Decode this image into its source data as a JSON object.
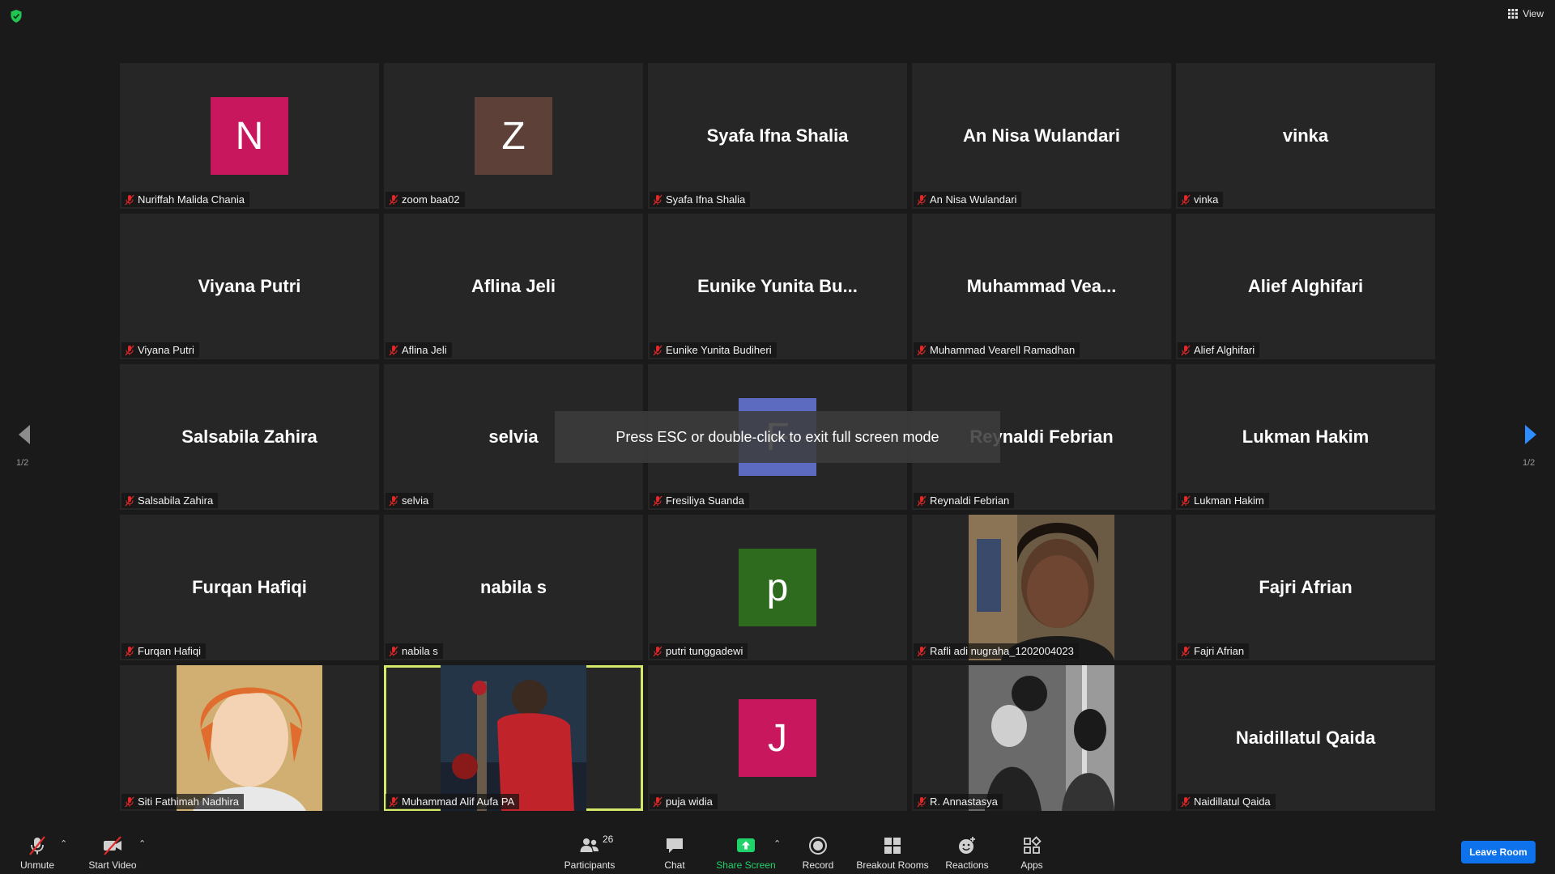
{
  "top_bar": {
    "view_label": "View",
    "security_icon": "shield-check-icon",
    "view_icon": "grid-icon"
  },
  "tiles": [
    {
      "display": "N",
      "avatar_color": "#c8175d",
      "name": "Nuriffah Malida Chania",
      "muted": true
    },
    {
      "display": "Z",
      "avatar_color": "#5d4037",
      "name": "zoom baa02",
      "muted": true
    },
    {
      "display": "Syafa Ifna Shalia",
      "name": "Syafa Ifna Shalia",
      "muted": true
    },
    {
      "display": "An Nisa Wulandari",
      "name": "An Nisa Wulandari",
      "muted": true
    },
    {
      "display": "vinka",
      "name": "vinka",
      "muted": true
    },
    {
      "display": "Viyana Putri",
      "name": "Viyana Putri",
      "muted": true
    },
    {
      "display": "Aflina Jeli",
      "name": "Aflina Jeli",
      "muted": true
    },
    {
      "display": "Eunike Yunita Bu...",
      "name": "Eunike Yunita Budiheri",
      "muted": true
    },
    {
      "display": "Muhammad Vea...",
      "name": "Muhammad Vearell Ramadhan",
      "muted": true
    },
    {
      "display": "Alief Alghifari",
      "name": "Alief Alghifari",
      "muted": true
    },
    {
      "display": "Salsabila Zahira",
      "name": "Salsabila Zahira",
      "muted": true
    },
    {
      "display": "selvia",
      "name": "selvia",
      "muted": true
    },
    {
      "display": "F",
      "avatar_color": "#5c6bc0",
      "name": "Fresiliya Suanda",
      "muted": true
    },
    {
      "display": "Reynaldi Febrian",
      "name": "Reynaldi Febrian",
      "muted": true
    },
    {
      "display": "Lukman Hakim",
      "name": "Lukman Hakim",
      "muted": true
    },
    {
      "display": "Furqan Hafiqi",
      "name": "Furqan Hafiqi",
      "muted": true
    },
    {
      "display": "nabila s",
      "name": "nabila s",
      "muted": true
    },
    {
      "display": "p",
      "avatar_color": "#2e6b1f",
      "name": "putri tunggadewi",
      "muted": true
    },
    {
      "display": "",
      "photo": "webcam-portrait",
      "name": "Rafli adi nugraha_1202004023",
      "muted": true
    },
    {
      "display": "Fajri Afrian",
      "name": "Fajri Afrian",
      "muted": true
    },
    {
      "display": "",
      "photo": "anime-portrait",
      "name": "Siti Fathimah Nadhira",
      "muted": true
    },
    {
      "display": "",
      "photo": "boxer-photo",
      "name": "Muhammad Alif Aufa PA",
      "muted": true,
      "active_speaker": true
    },
    {
      "display": "J",
      "avatar_color": "#c8175d",
      "name": "puja widia",
      "muted": true
    },
    {
      "display": "",
      "photo": "group-bw-photo",
      "name": "R. Annastasya",
      "muted": true
    },
    {
      "display": "Naidillatul Qaida",
      "name": "Naidillatul Qaida",
      "muted": true
    }
  ],
  "pagination": {
    "left": "1/2",
    "right": "1/2"
  },
  "fullscreen_toast": "Press ESC or double-click to exit full screen mode",
  "toolbar": {
    "unmute": "Unmute",
    "start_video": "Start Video",
    "participants": "Participants",
    "participants_count": "26",
    "chat": "Chat",
    "share_screen": "Share Screen",
    "record": "Record",
    "breakout_rooms": "Breakout Rooms",
    "reactions": "Reactions",
    "apps": "Apps",
    "leave_room": "Leave Room"
  },
  "colors": {
    "background": "#1a1a1a",
    "tile": "#262626",
    "active_border": "#d6e86c",
    "share_green": "#1fd36a",
    "leave_blue": "#0e72ed",
    "mute_red": "#e02828"
  }
}
